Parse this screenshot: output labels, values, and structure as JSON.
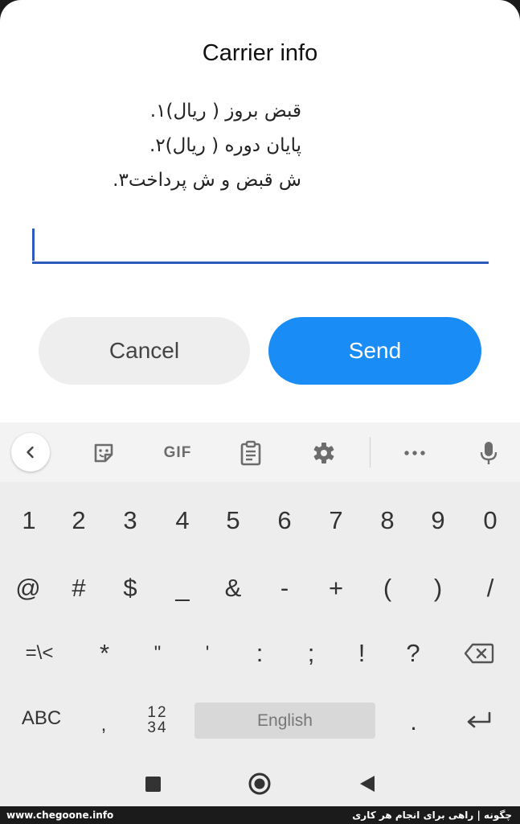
{
  "dialog": {
    "title": "Carrier info",
    "message_lines": [
      "قبض بروز (            ریال)۱.",
      "پایان دوره (          ریال)۲.",
      "ش قبض و ش پرداخت۳."
    ],
    "input_value": "",
    "cancel_label": "Cancel",
    "send_label": "Send",
    "colors": {
      "accent": "#1a8cf5",
      "underline": "#2d5bbd"
    }
  },
  "keyboard": {
    "toolbar": {
      "back_icon": "chevron-left-icon",
      "sticker_icon": "sticker-icon",
      "gif_label": "GIF",
      "clipboard_icon": "clipboard-icon",
      "settings_icon": "gear-icon",
      "more_icon": "more-horizontal-icon",
      "mic_icon": "microphone-icon"
    },
    "row1": [
      "1",
      "2",
      "3",
      "4",
      "5",
      "6",
      "7",
      "8",
      "9",
      "0"
    ],
    "row2": [
      "@",
      "#",
      "$",
      "_",
      "&",
      "-",
      "+",
      "(",
      ")",
      "/"
    ],
    "row3": [
      "=\\<",
      "*",
      "\"",
      "'",
      ":",
      ";",
      "!",
      "?"
    ],
    "row3_backspace_icon": "backspace-icon",
    "bottom": {
      "abc_label": "ABC",
      "comma_label": ",",
      "numpad_top": "12",
      "numpad_bottom": "34",
      "space_label": "English",
      "period_label": ".",
      "enter_icon": "enter-icon"
    }
  },
  "navbar": {
    "recents_icon": "square-icon",
    "home_icon": "circle-icon",
    "back_icon": "triangle-back-icon"
  },
  "footer": {
    "left_text": "www.chegoone.info",
    "right_text": "چگونه | راهی برای انجام هر کاری"
  }
}
